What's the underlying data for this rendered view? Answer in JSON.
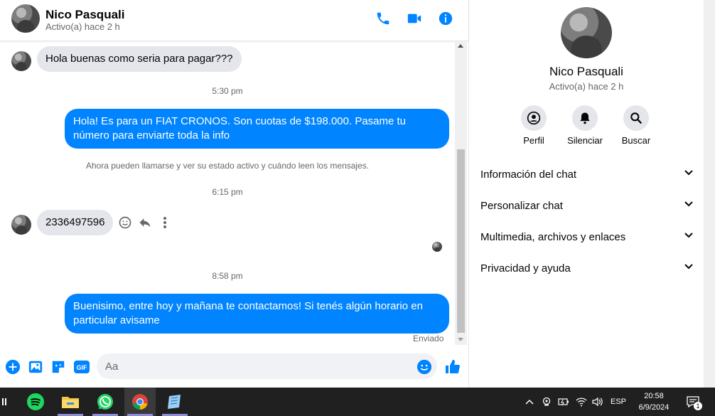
{
  "header": {
    "name": "Nico Pasquali",
    "status": "Activo(a) hace 2 h",
    "icons": [
      "phone-icon",
      "video-icon",
      "info-icon"
    ]
  },
  "messages": {
    "m1_text": "Hola buenas como seria para pagar???",
    "t1": "5:30 pm",
    "m2_text": "Hola! Es para un FIAT CRONOS. Son cuotas de $198.000. Pasame tu número para enviarte toda la info",
    "sys": "Ahora pueden llamarse y ver su estado activo y cuándo leen los mensajes.",
    "t2": "6:15 pm",
    "m3_text": "2336497596",
    "t3": "8:58 pm",
    "m4_text": "Buenisimo, entre hoy y mañana te contactamos! Si tenés algún horario en particular avisame",
    "sent_label": "Enviado"
  },
  "composer": {
    "placeholder": "Aa"
  },
  "panel": {
    "name": "Nico Pasquali",
    "status": "Activo(a) hace 2 h",
    "actions": [
      {
        "label": "Perfil",
        "icon": "profile-icon"
      },
      {
        "label": "Silenciar",
        "icon": "bell-icon"
      },
      {
        "label": "Buscar",
        "icon": "search-icon"
      }
    ],
    "sections": [
      {
        "label": "Información del chat"
      },
      {
        "label": "Personalizar chat"
      },
      {
        "label": "Multimedia, archivos y enlaces"
      },
      {
        "label": "Privacidad y ayuda"
      }
    ]
  },
  "taskbar": {
    "lang": "ESP",
    "time": "20:58",
    "date": "6/9/2024",
    "notif_count": "1"
  },
  "colors": {
    "accent": "#0084ff",
    "incoming_bubble": "#e4e6eb",
    "taskbar": "#202020"
  }
}
